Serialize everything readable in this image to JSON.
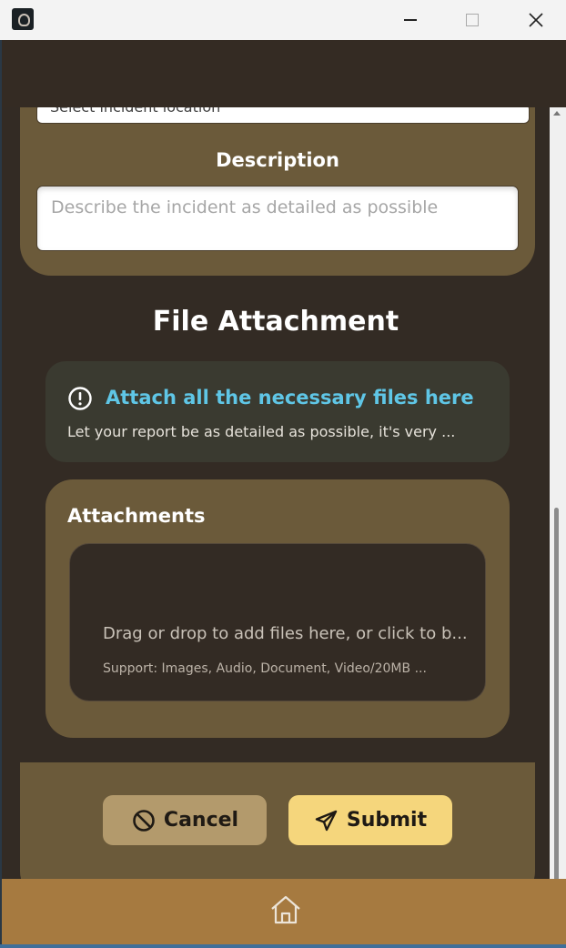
{
  "form": {
    "location_placeholder": "Select incident location",
    "description_label": "Description",
    "description_placeholder": "Describe the incident as detailed as possible"
  },
  "file_attachment": {
    "title": "File Attachment",
    "info": {
      "icon": "info-circle-icon",
      "title": "Attach all the necessary files here",
      "text": "Let your report be as detailed as possible, it's very ..."
    },
    "attachments_label": "Attachments",
    "drop_text": "Drag or drop to add files here, or click to b...",
    "support_text": "Support: Images, Audio, Document, Video/20MB ..."
  },
  "actions": {
    "cancel_label": "Cancel",
    "submit_label": "Submit"
  },
  "nav": {
    "home_icon": "home-icon"
  },
  "colors": {
    "background": "#332b24",
    "card": "#6b5a3a",
    "accent": "#5fc6e6",
    "cancel": "#b39a6c",
    "submit": "#f5d67c",
    "nav": "#a67a40"
  }
}
